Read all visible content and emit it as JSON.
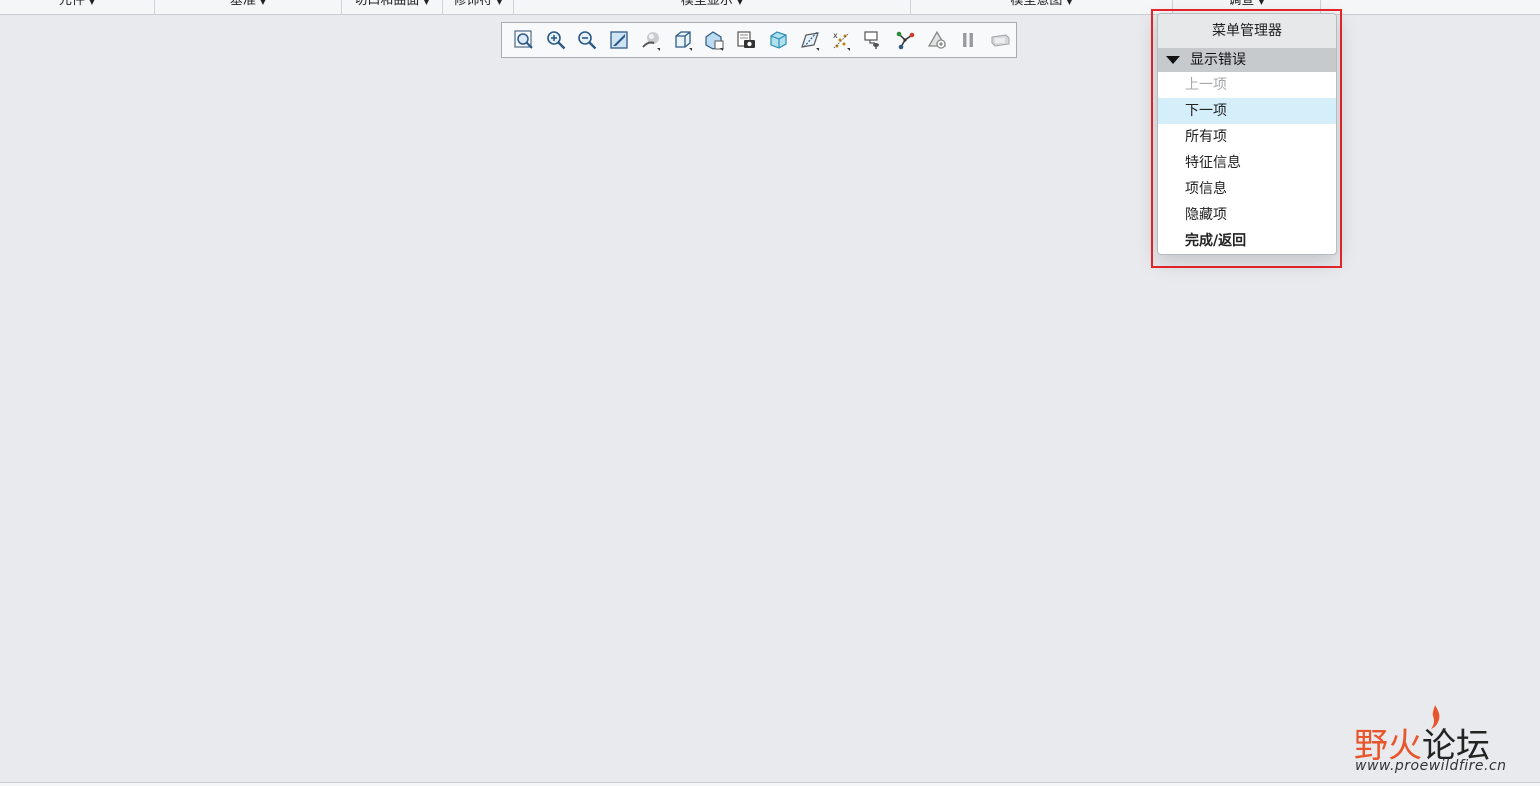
{
  "ribbon": {
    "groups": [
      {
        "label": "元件"
      },
      {
        "label": "基准"
      },
      {
        "label": "切口和曲面"
      },
      {
        "label": "修饰符"
      },
      {
        "label": "模型显示"
      },
      {
        "label": "模型意图"
      },
      {
        "label": "调查"
      }
    ]
  },
  "graphics_toolbar": {
    "tools": [
      {
        "icon": "refit-icon"
      },
      {
        "icon": "zoom-in-icon"
      },
      {
        "icon": "zoom-out-icon"
      },
      {
        "icon": "repaint-icon"
      },
      {
        "icon": "spin-center-icon"
      },
      {
        "icon": "saved-orientations-icon"
      },
      {
        "icon": "view-manager-icon"
      },
      {
        "icon": "perspective-icon"
      },
      {
        "icon": "display-style-icon"
      },
      {
        "icon": "datum-display-icon"
      },
      {
        "icon": "annotation-display-icon"
      },
      {
        "icon": "section-icon"
      },
      {
        "icon": "network-icon"
      },
      {
        "icon": "regenerate-icon"
      },
      {
        "icon": "pause-icon"
      },
      {
        "icon": "appearance-icon"
      }
    ]
  },
  "menu_manager": {
    "title": "菜单管理器",
    "section": "显示错误",
    "items": [
      {
        "label": "上一项",
        "state": "disabled"
      },
      {
        "label": "下一项",
        "state": "hover"
      },
      {
        "label": "所有项",
        "state": "normal"
      },
      {
        "label": "特征信息",
        "state": "normal"
      },
      {
        "label": "项信息",
        "state": "normal"
      },
      {
        "label": "隐藏项",
        "state": "normal"
      },
      {
        "label": "完成/返回",
        "state": "bold"
      }
    ]
  },
  "watermark": {
    "part1": "野火",
    "part2": "论坛",
    "url": "www.proewildfire.cn"
  },
  "colors": {
    "canvas": "#e8eaed",
    "highlight_frame": "#e8262b",
    "hover_row": "#d4eefa",
    "watermark_accent": "#e8552a"
  }
}
